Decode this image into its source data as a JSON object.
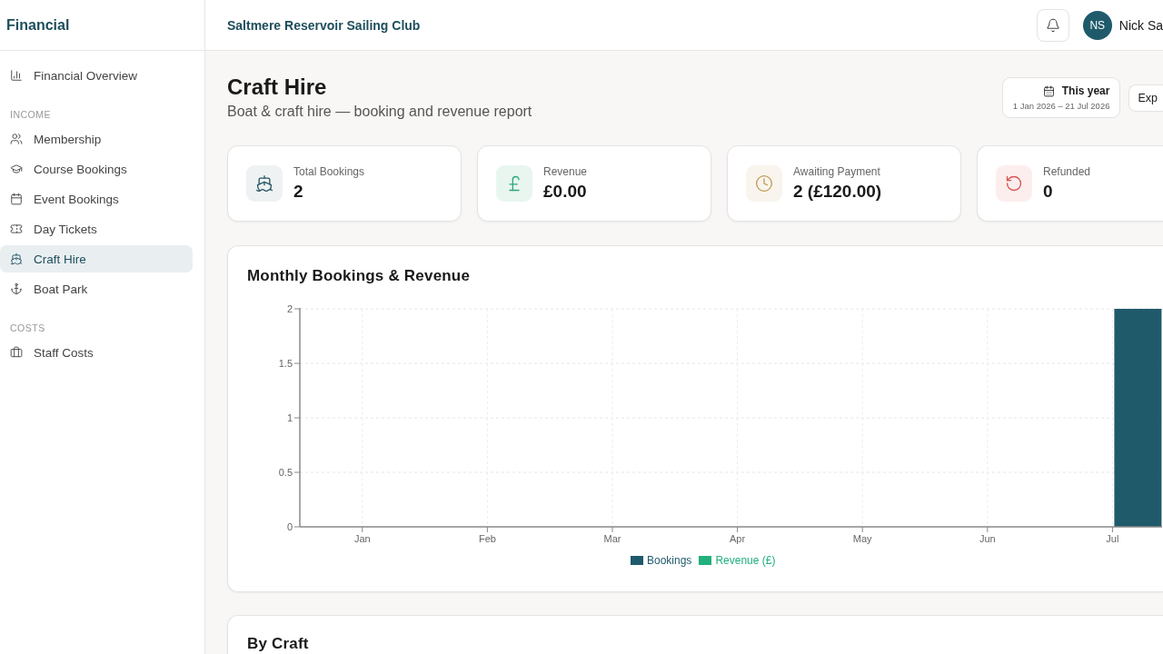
{
  "sidebar": {
    "title": "Financial",
    "sections": [
      {
        "items": [
          {
            "label": "Financial Overview",
            "selected": false
          }
        ]
      },
      {
        "heading": "INCOME",
        "items": [
          {
            "label": "Membership",
            "selected": false
          },
          {
            "label": "Course Bookings",
            "selected": false
          },
          {
            "label": "Event Bookings",
            "selected": false
          },
          {
            "label": "Day Tickets",
            "selected": false
          },
          {
            "label": "Craft Hire",
            "selected": true
          },
          {
            "label": "Boat Park",
            "selected": false
          }
        ]
      },
      {
        "heading": "COSTS",
        "items": [
          {
            "label": "Staff Costs",
            "selected": false
          }
        ]
      }
    ]
  },
  "header": {
    "club_name": "Saltmere Reservoir Sailing Club",
    "user": {
      "initials": "NS",
      "name": "Nick Sa"
    }
  },
  "page": {
    "title": "Craft Hire",
    "subtitle": "Boat & craft hire — booking and revenue report",
    "date_range": {
      "label": "This year",
      "range": "1 Jan 2026 – 21 Jul 2026"
    },
    "export_button": "Exp"
  },
  "stats": [
    {
      "label": "Total Bookings",
      "value": "2"
    },
    {
      "label": "Revenue",
      "value": "£0.00"
    },
    {
      "label": "Awaiting Payment",
      "value": "2 (£120.00)"
    },
    {
      "label": "Refunded",
      "value": "0"
    }
  ],
  "chart": {
    "title": "Monthly Bookings & Revenue",
    "chart_data": {
      "type": "bar",
      "grid": true,
      "categories": [
        "Jan",
        "Feb",
        "Mar",
        "Apr",
        "May",
        "Jun",
        "Jul"
      ],
      "series": [
        {
          "name": "Bookings",
          "color": "#1f5a6b",
          "values": [
            0,
            0,
            0,
            0,
            0,
            0,
            2
          ]
        },
        {
          "name": "Revenue (£)",
          "color": "#22b07d",
          "values": [
            0,
            0,
            0,
            0,
            0,
            0,
            0
          ]
        }
      ],
      "ylim": [
        0,
        2
      ],
      "yticks": [
        0,
        0.5,
        1,
        1.5,
        2
      ]
    }
  },
  "by_craft": {
    "title": "By Craft"
  }
}
